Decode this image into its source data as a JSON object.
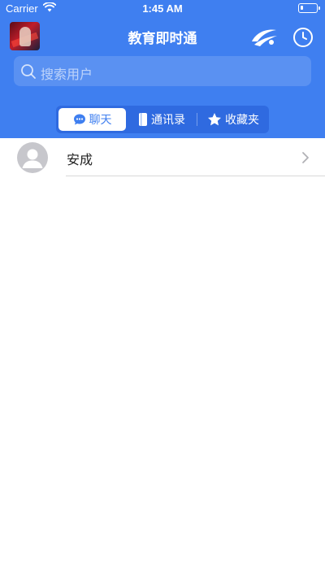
{
  "status_bar": {
    "carrier": "Carrier",
    "time": "1:45 AM",
    "battery_level": 0.15
  },
  "header": {
    "title": "教育即时通",
    "logo_icon": "swoosh-logo-icon",
    "clock_icon": "clock-icon",
    "background_color": "#3f7ff0"
  },
  "search": {
    "placeholder": "搜索用户"
  },
  "tabs": [
    {
      "label": "聊天",
      "icon": "chat-bubble-icon",
      "selected": true
    },
    {
      "label": "通讯录",
      "icon": "address-book-icon",
      "selected": false
    },
    {
      "label": "收藏夹",
      "icon": "star-icon",
      "selected": false
    }
  ],
  "contacts": [
    {
      "name": "安成",
      "avatar": "default-person-avatar"
    }
  ]
}
